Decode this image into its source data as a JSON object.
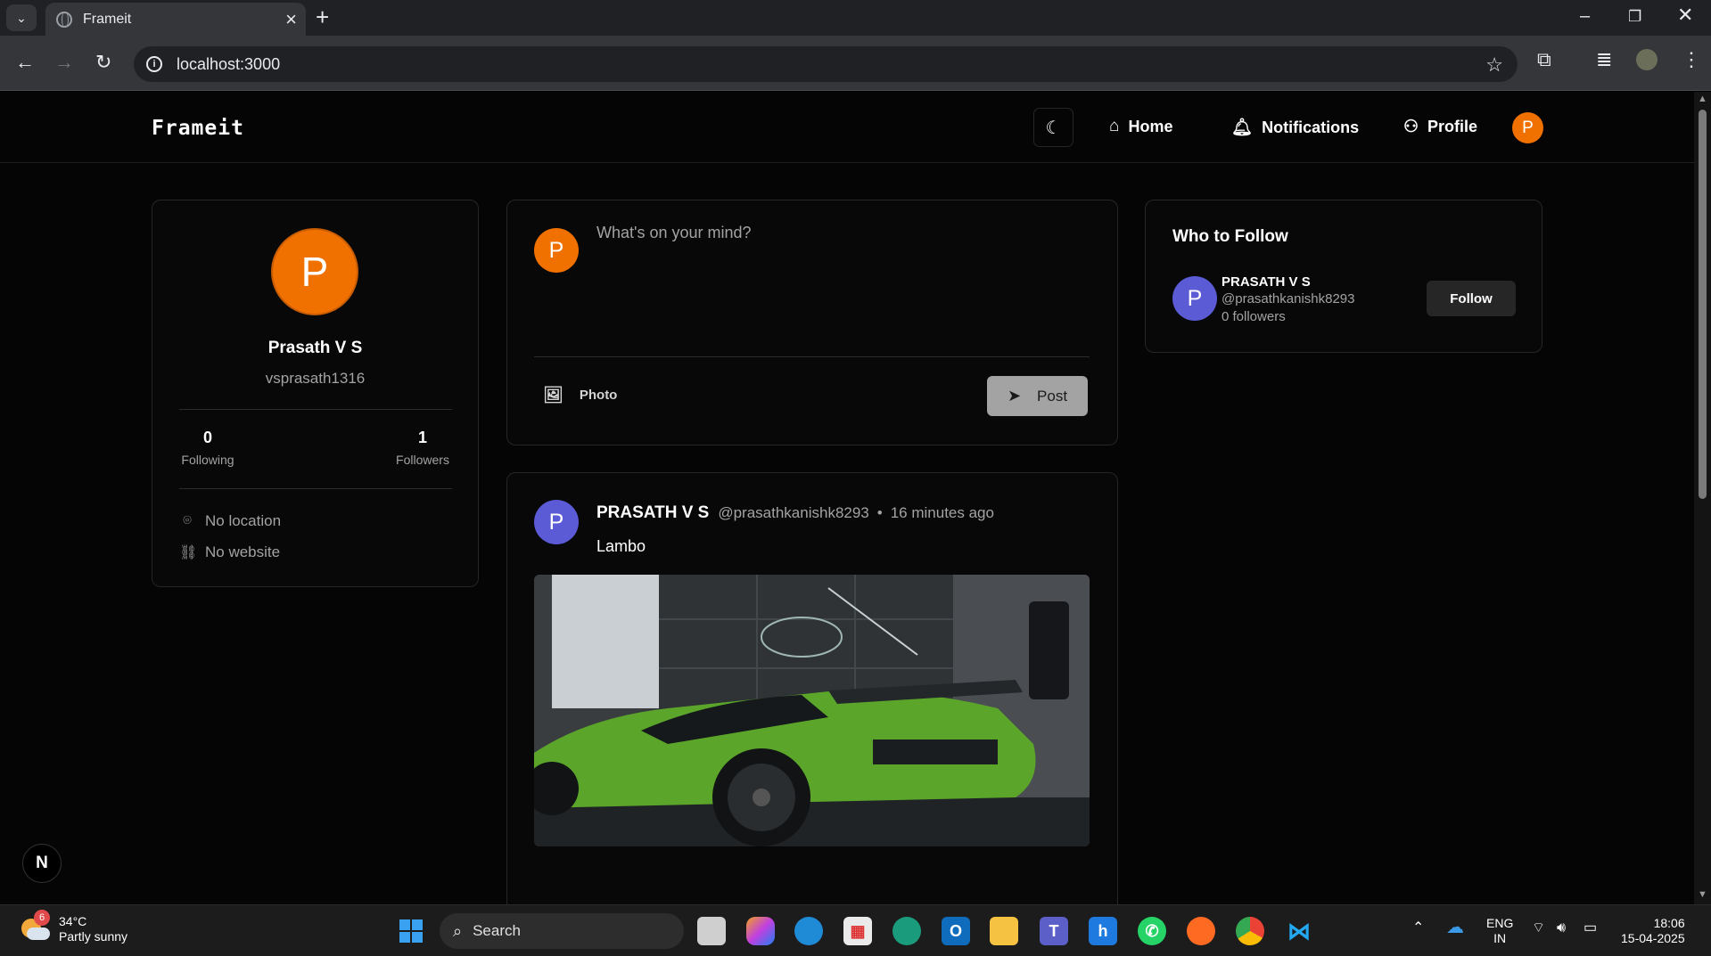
{
  "browser": {
    "tab_title": "Frameit",
    "url": "localhost:3000"
  },
  "app": {
    "brand": "Frameit",
    "nav": {
      "home": "Home",
      "notifications": "Notifications",
      "profile": "Profile"
    },
    "header_avatar_initial": "P"
  },
  "profile_card": {
    "initial": "P",
    "name": "Prasath V S",
    "handle": "vsprasath1316",
    "following_count": "0",
    "following_label": "Following",
    "followers_count": "1",
    "followers_label": "Followers",
    "location": "No location",
    "website": "No website"
  },
  "composer": {
    "initial": "P",
    "placeholder": "What's on your mind?",
    "photo_label": "Photo",
    "post_label": "Post"
  },
  "feed": [
    {
      "initial": "P",
      "author": "PRASATH V S",
      "handle": "@prasathkanishk8293",
      "separator": "•",
      "time": "16 minutes ago",
      "text": "Lambo"
    }
  ],
  "who_to_follow": {
    "title": "Who to Follow",
    "users": [
      {
        "initial": "P",
        "name": "PRASATH V S",
        "handle": "@prasathkanishk8293",
        "followers": "0 followers",
        "button": "Follow"
      }
    ]
  },
  "dev_badge": "N",
  "taskbar": {
    "weather_badge": "6",
    "temperature": "34°C",
    "condition": "Partly sunny",
    "search_label": "Search",
    "lang_line1": "ENG",
    "lang_line2": "IN",
    "time": "18:06",
    "date": "15-04-2025"
  },
  "colors": {
    "accent_orange": "#f07100",
    "avatar_indigo": "#5b5bd6",
    "page_bg": "#050505",
    "card_border": "#262626"
  }
}
